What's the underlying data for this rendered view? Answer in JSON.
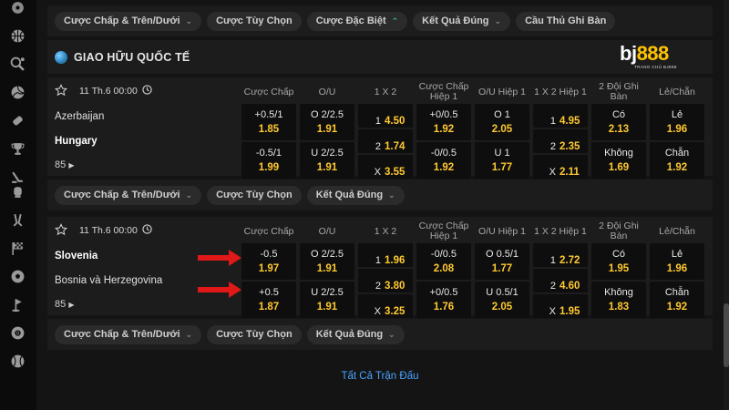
{
  "top_filters": [
    {
      "label": "Cược Chấp & Trên/Dưới",
      "chevron": "down"
    },
    {
      "label": "Cược Tùy Chọn",
      "chevron": "none"
    },
    {
      "label": "Cược Đặc Biệt",
      "chevron": "up-double"
    },
    {
      "label": "Kết Quả Đúng",
      "chevron": "down"
    },
    {
      "label": "Cầu Thủ Ghi Bàn",
      "chevron": "none"
    }
  ],
  "league": {
    "name": "GIAO HỮU QUỐC TẾ",
    "logo_text": "bj",
    "logo_number": "888",
    "logo_sub": "TRANG CHỦ BJ888"
  },
  "column_headers": [
    "Cược Chấp",
    "O/U",
    "1 X 2",
    "Cược Chấp Hiệp 1",
    "O/U Hiệp 1",
    "1 X 2 Hiệp 1",
    "2 Đội Ghi Bàn",
    "Lẻ/Chẵn"
  ],
  "matches": [
    {
      "kickoff": "11 Th.6 00:00",
      "home": "Azerbaijan",
      "away": "Hungary",
      "more": "85",
      "row1": [
        {
          "label": "+0.5/1",
          "odd": "1.85"
        },
        {
          "label": "O 2/2.5",
          "odd": "1.91"
        },
        {
          "label": "1",
          "odd": "4.50"
        },
        {
          "label": "+0/0.5",
          "odd": "1.92"
        },
        {
          "label": "O 1",
          "odd": "2.05"
        },
        {
          "label": "1",
          "odd": "4.95"
        },
        {
          "label": "Có",
          "odd": "2.13"
        },
        {
          "label": "Lẻ",
          "odd": "1.96"
        }
      ],
      "draw": [
        {
          "label": "2",
          "odd": "1.74"
        },
        {
          "label": "2",
          "odd": "2.35"
        }
      ],
      "row2": [
        {
          "label": "-0.5/1",
          "odd": "1.99"
        },
        {
          "label": "U 2/2.5",
          "odd": "1.91"
        },
        {
          "label": "X",
          "odd": "3.55"
        },
        {
          "label": "-0/0.5",
          "odd": "1.92"
        },
        {
          "label": "U 1",
          "odd": "1.77"
        },
        {
          "label": "X",
          "odd": "2.11"
        },
        {
          "label": "Không",
          "odd": "1.69"
        },
        {
          "label": "Chẵn",
          "odd": "1.92"
        }
      ],
      "filters": [
        {
          "label": "Cược Chấp & Trên/Dưới",
          "chevron": "down"
        },
        {
          "label": "Cược Tùy Chọn",
          "chevron": "none"
        },
        {
          "label": "Kết Quả Đúng",
          "chevron": "down"
        }
      ]
    },
    {
      "kickoff": "11 Th.6 00:00",
      "home": "Slovenia",
      "away": "Bosnia và Herzegovina",
      "more": "85",
      "row1": [
        {
          "label": "-0.5",
          "odd": "1.97"
        },
        {
          "label": "O 2/2.5",
          "odd": "1.91"
        },
        {
          "label": "1",
          "odd": "1.96"
        },
        {
          "label": "-0/0.5",
          "odd": "2.08"
        },
        {
          "label": "O 0.5/1",
          "odd": "1.77"
        },
        {
          "label": "1",
          "odd": "2.72"
        },
        {
          "label": "Có",
          "odd": "1.95"
        },
        {
          "label": "Lẻ",
          "odd": "1.96"
        }
      ],
      "draw": [
        {
          "label": "2",
          "odd": "3.80"
        },
        {
          "label": "2",
          "odd": "4.60"
        }
      ],
      "row2": [
        {
          "label": "+0.5",
          "odd": "1.87"
        },
        {
          "label": "U 2/2.5",
          "odd": "1.91"
        },
        {
          "label": "X",
          "odd": "3.25"
        },
        {
          "label": "+0/0.5",
          "odd": "1.76"
        },
        {
          "label": "U 0.5/1",
          "odd": "2.05"
        },
        {
          "label": "X",
          "odd": "1.95"
        },
        {
          "label": "Không",
          "odd": "1.83"
        },
        {
          "label": "Chẵn",
          "odd": "1.92"
        }
      ],
      "filters": [
        {
          "label": "Cược Chấp & Trên/Dưới",
          "chevron": "down"
        },
        {
          "label": "Cược Tùy Chọn",
          "chevron": "none"
        },
        {
          "label": "Kết Quả Đúng",
          "chevron": "down"
        }
      ]
    }
  ],
  "footer_link": "Tất Cả Trận Đấu",
  "colors": {
    "background": "#141414",
    "panel": "#1c1c1c",
    "cell": "#0e0e0e",
    "odd_text": "#ffc930",
    "link": "#4aa3ff",
    "arrow": "#e01818"
  },
  "sidebar_icons": [
    "ball-icon",
    "basketball-icon",
    "tennis-icon",
    "volleyball-icon",
    "badminton-icon",
    "trophy-icon",
    "ice-hockey-icon",
    "boxing-icon",
    "hockey-stick-icon",
    "racing-flag-icon",
    "soccer-icon",
    "golf-icon",
    "snooker-icon",
    "baseball-icon"
  ]
}
